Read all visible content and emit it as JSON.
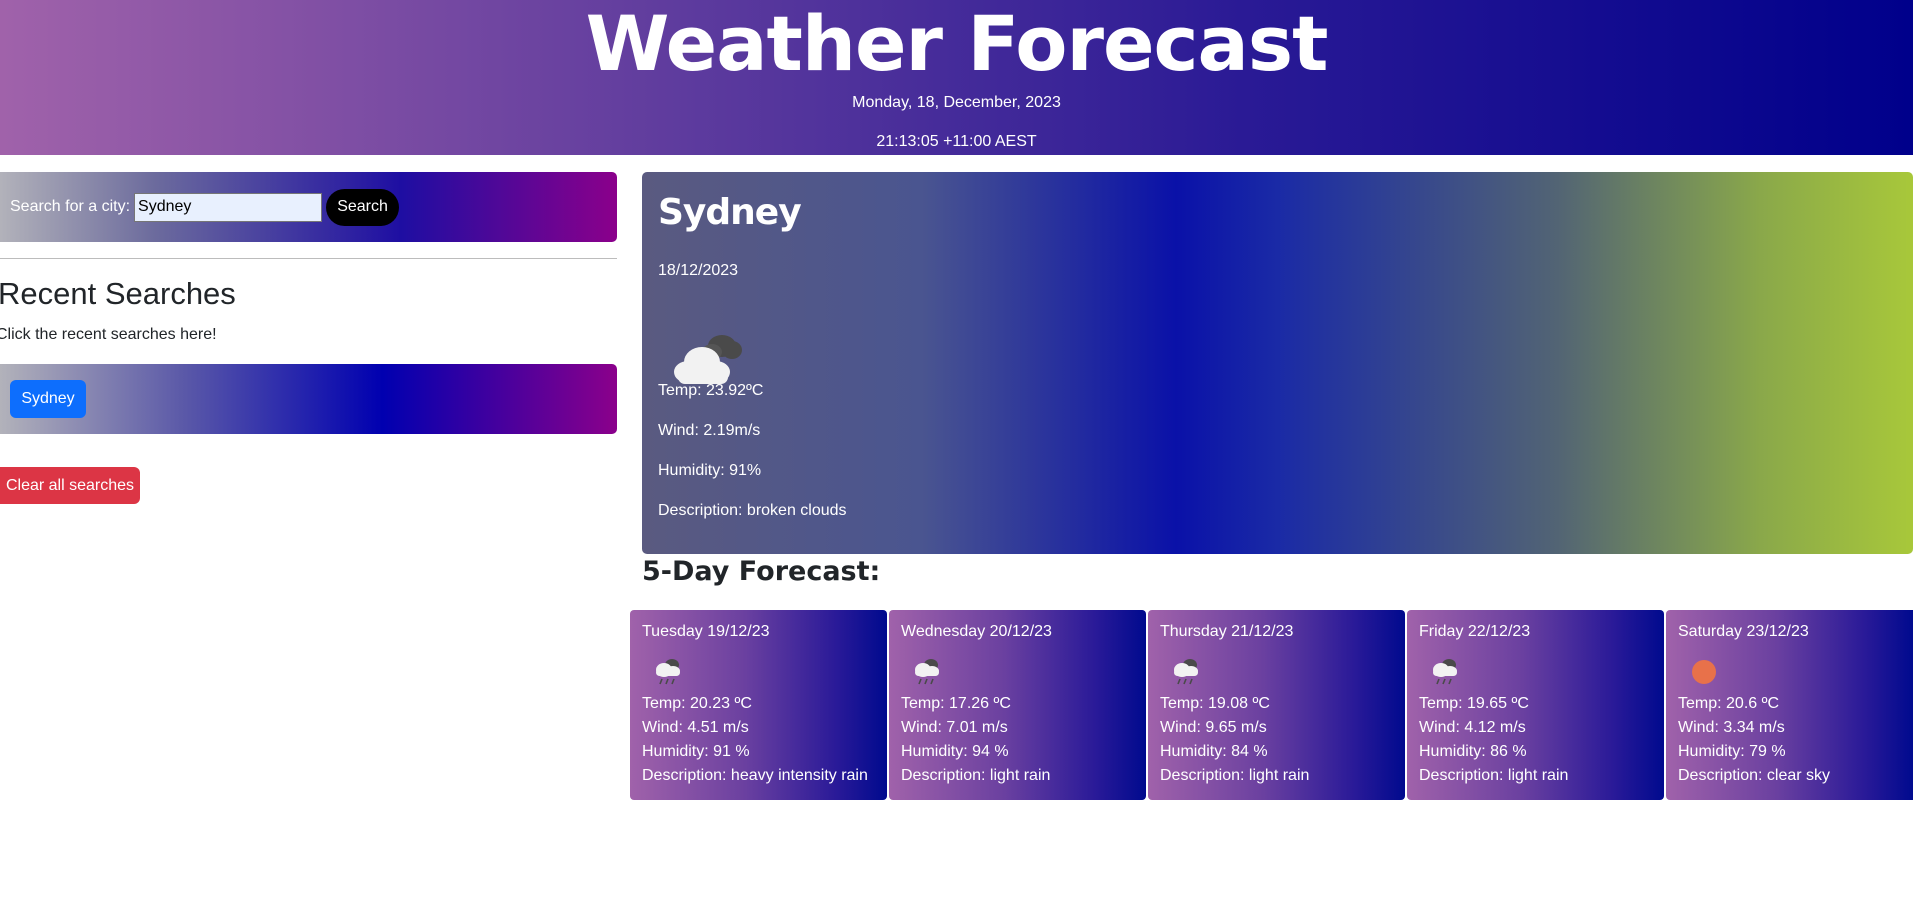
{
  "header": {
    "title": "Weather Forecast",
    "date": "Monday, 18, December, 2023",
    "time": "21:13:05 +11:00 AEST"
  },
  "search": {
    "label": "Search for a city:",
    "value": "Sydney",
    "button_label": "Search"
  },
  "recent": {
    "title": "Recent Searches",
    "subtitle": "Click the recent searches here!",
    "items": [
      "Sydney"
    ],
    "clear_label": "Clear all searches"
  },
  "current": {
    "city": "Sydney",
    "date": "18/12/2023",
    "icon": "broken-clouds-icon",
    "temp": "Temp: 23.92ºC",
    "wind": "Wind: 2.19m/s",
    "humidity": "Humidity: 91%",
    "description": "Description: broken clouds"
  },
  "forecast": {
    "title": "5-Day Forecast:",
    "days": [
      {
        "date": "Tuesday 19/12/23",
        "icon": "rain-icon",
        "temp": "Temp: 20.23 ºC",
        "wind": "Wind: 4.51 m/s",
        "humidity": "Humidity: 91 %",
        "description": "Description: heavy intensity rain"
      },
      {
        "date": "Wednesday 20/12/23",
        "icon": "rain-icon",
        "temp": "Temp: 17.26 ºC",
        "wind": "Wind: 7.01 m/s",
        "humidity": "Humidity: 94 %",
        "description": "Description: light rain"
      },
      {
        "date": "Thursday 21/12/23",
        "icon": "rain-icon",
        "temp": "Temp: 19.08 ºC",
        "wind": "Wind: 9.65 m/s",
        "humidity": "Humidity: 84 %",
        "description": "Description: light rain"
      },
      {
        "date": "Friday 22/12/23",
        "icon": "rain-icon",
        "temp": "Temp: 19.65 ºC",
        "wind": "Wind: 4.12 m/s",
        "humidity": "Humidity: 86 %",
        "description": "Description: light rain"
      },
      {
        "date": "Saturday 23/12/23",
        "icon": "clear-sky-icon",
        "temp": "Temp: 20.6 ºC",
        "wind": "Wind: 3.34 m/s",
        "humidity": "Humidity: 79 %",
        "description": "Description: clear sky"
      }
    ]
  },
  "colors": {
    "search_button": "#000000",
    "recent_button": "#0d6efd",
    "clear_button": "#dc3545",
    "sun": "#e8714a"
  }
}
